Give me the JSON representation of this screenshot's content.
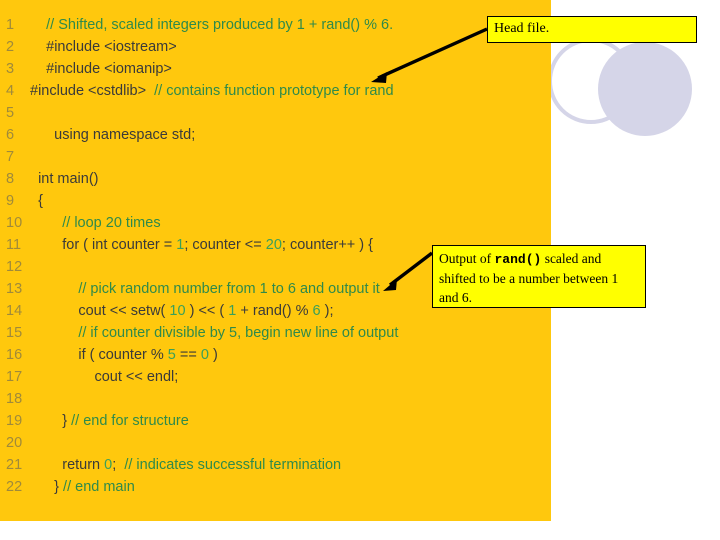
{
  "slide": {
    "panel_color": "#ffc80d",
    "background_color": "#ffffff",
    "callout_fill": "#ffff00",
    "callout_border": "#000000",
    "decoration_color": "#d5d5e8",
    "line_number_color": "#a08a3a",
    "comment_color": "#2f8a4a",
    "code_color": "#3a3a3a"
  },
  "code": {
    "language": "C++",
    "lines": [
      {
        "n": "1",
        "indent": 2,
        "segments": [
          {
            "t": "// Shifted, scaled integers produced by 1 + rand() % 6.",
            "c": "cmt"
          }
        ]
      },
      {
        "n": "2",
        "indent": 2,
        "segments": [
          {
            "t": "#include <iostream>",
            "c": "kw"
          }
        ]
      },
      {
        "n": "3",
        "indent": 2,
        "segments": [
          {
            "t": "#include <iomanip>",
            "c": "kw"
          }
        ]
      },
      {
        "n": "4",
        "indent": 0,
        "segments": [
          {
            "t": "#include <cstdlib>  ",
            "c": "kw"
          },
          {
            "t": "// contains function prototype for rand",
            "c": "cmt"
          }
        ]
      },
      {
        "n": "5",
        "indent": 0,
        "segments": []
      },
      {
        "n": "6",
        "indent": 3,
        "segments": [
          {
            "t": "using namespace std;",
            "c": "kw"
          }
        ]
      },
      {
        "n": "7",
        "indent": 0,
        "segments": []
      },
      {
        "n": "8",
        "indent": 1,
        "segments": [
          {
            "t": "int main()",
            "c": "kw"
          }
        ]
      },
      {
        "n": "9",
        "indent": 1,
        "segments": [
          {
            "t": "{",
            "c": "kw"
          }
        ]
      },
      {
        "n": "10",
        "indent": 4,
        "segments": [
          {
            "t": "// loop 20 times",
            "c": "cmt"
          }
        ]
      },
      {
        "n": "11",
        "indent": 4,
        "segments": [
          {
            "t": "for ( int counter = ",
            "c": "kw"
          },
          {
            "t": "1",
            "c": "num"
          },
          {
            "t": "; counter <= ",
            "c": "kw"
          },
          {
            "t": "20",
            "c": "num"
          },
          {
            "t": "; counter++ ) {",
            "c": "kw"
          }
        ]
      },
      {
        "n": "12",
        "indent": 0,
        "segments": []
      },
      {
        "n": "13",
        "indent": 6,
        "segments": [
          {
            "t": "// pick random number from 1 to 6 and output it",
            "c": "cmt"
          }
        ]
      },
      {
        "n": "14",
        "indent": 6,
        "segments": [
          {
            "t": "cout << setw( ",
            "c": "kw"
          },
          {
            "t": "10",
            "c": "num"
          },
          {
            "t": " ) << ( ",
            "c": "kw"
          },
          {
            "t": "1",
            "c": "num"
          },
          {
            "t": " + rand() % ",
            "c": "kw"
          },
          {
            "t": "6",
            "c": "num"
          },
          {
            "t": " );",
            "c": "kw"
          }
        ]
      },
      {
        "n": "15",
        "indent": 6,
        "segments": [
          {
            "t": "// if counter divisible by 5, begin new line of output",
            "c": "cmt"
          }
        ]
      },
      {
        "n": "16",
        "indent": 6,
        "segments": [
          {
            "t": "if ( counter % ",
            "c": "kw"
          },
          {
            "t": "5",
            "c": "num"
          },
          {
            "t": " == ",
            "c": "kw"
          },
          {
            "t": "0",
            "c": "num"
          },
          {
            "t": " )",
            "c": "kw"
          }
        ]
      },
      {
        "n": "17",
        "indent": 8,
        "segments": [
          {
            "t": "cout << endl;",
            "c": "kw"
          }
        ]
      },
      {
        "n": "18",
        "indent": 0,
        "segments": []
      },
      {
        "n": "19",
        "indent": 4,
        "segments": [
          {
            "t": "} ",
            "c": "kw"
          },
          {
            "t": "// end for structure",
            "c": "cmt"
          }
        ]
      },
      {
        "n": "20",
        "indent": 0,
        "segments": []
      },
      {
        "n": "21",
        "indent": 4,
        "segments": [
          {
            "t": "return ",
            "c": "kw"
          },
          {
            "t": "0",
            "c": "num"
          },
          {
            "t": ";  ",
            "c": "kw"
          },
          {
            "t": "// indicates successful termination",
            "c": "cmt"
          }
        ]
      },
      {
        "n": "22",
        "indent": 3,
        "segments": [
          {
            "t": "} ",
            "c": "kw"
          },
          {
            "t": "// end main",
            "c": "cmt"
          }
        ]
      }
    ]
  },
  "callouts": {
    "head_file": {
      "text": "Head file."
    },
    "rand_output": {
      "part1": "Output of ",
      "code": "rand()",
      "part2": " scaled and shifted to be a number between 1 and 6."
    }
  }
}
